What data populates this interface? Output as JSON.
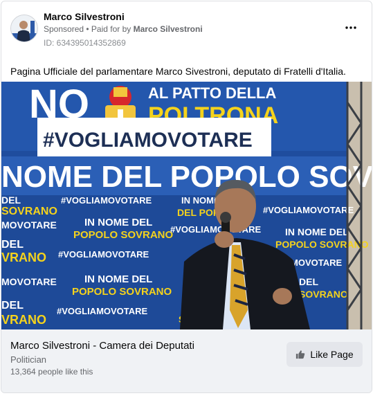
{
  "post": {
    "author": "Marco Silvestroni",
    "sponsored_label": "Sponsored",
    "separator": " • ",
    "paid_for_prefix": "Paid for by ",
    "paid_for_name": "Marco Silvestroni",
    "ad_id": "ID: 634395014352869",
    "text": "Pagina Ufficiale del parlamentare Marco Sivestroni, deputato di Fratelli d'Italia."
  },
  "photo": {
    "banner_top_line": "AL PATTO DELLA",
    "banner_poltrona": "POLTRONA",
    "banner_no": "NO",
    "banner_hashtag": "#VOGLIAMOVOTARE",
    "banner_big": "NOME DEL POPOLO SOVRANO",
    "tile_hashtag": "#VOGLIAMOVOTARE",
    "tile_in_nome": "IN NOME",
    "tile_del_popolo": "DEL POPOLO",
    "tile_sovrano": "SOVRANO",
    "tile_in_nome_del": "IN NOME DEL",
    "tile_popolo_sovrano": "POPOLO SOVRANO",
    "tile_movotare": "MOVOTARE",
    "tile_del": "DEL",
    "tile_vrano": "VRANO"
  },
  "footer": {
    "page_name": "Marco Silvestroni - Camera dei Deputati",
    "category": "Politician",
    "likes": "13,364 people like this",
    "like_button": "Like Page"
  },
  "icons": {
    "more": "more-options-icon",
    "like": "thumbs-up-icon"
  },
  "colors": {
    "banner_blue": "#1f4d9e",
    "banner_yellow": "#f5d31c",
    "button_grey": "#e4e6eb",
    "footer_bg": "#f0f2f5"
  }
}
